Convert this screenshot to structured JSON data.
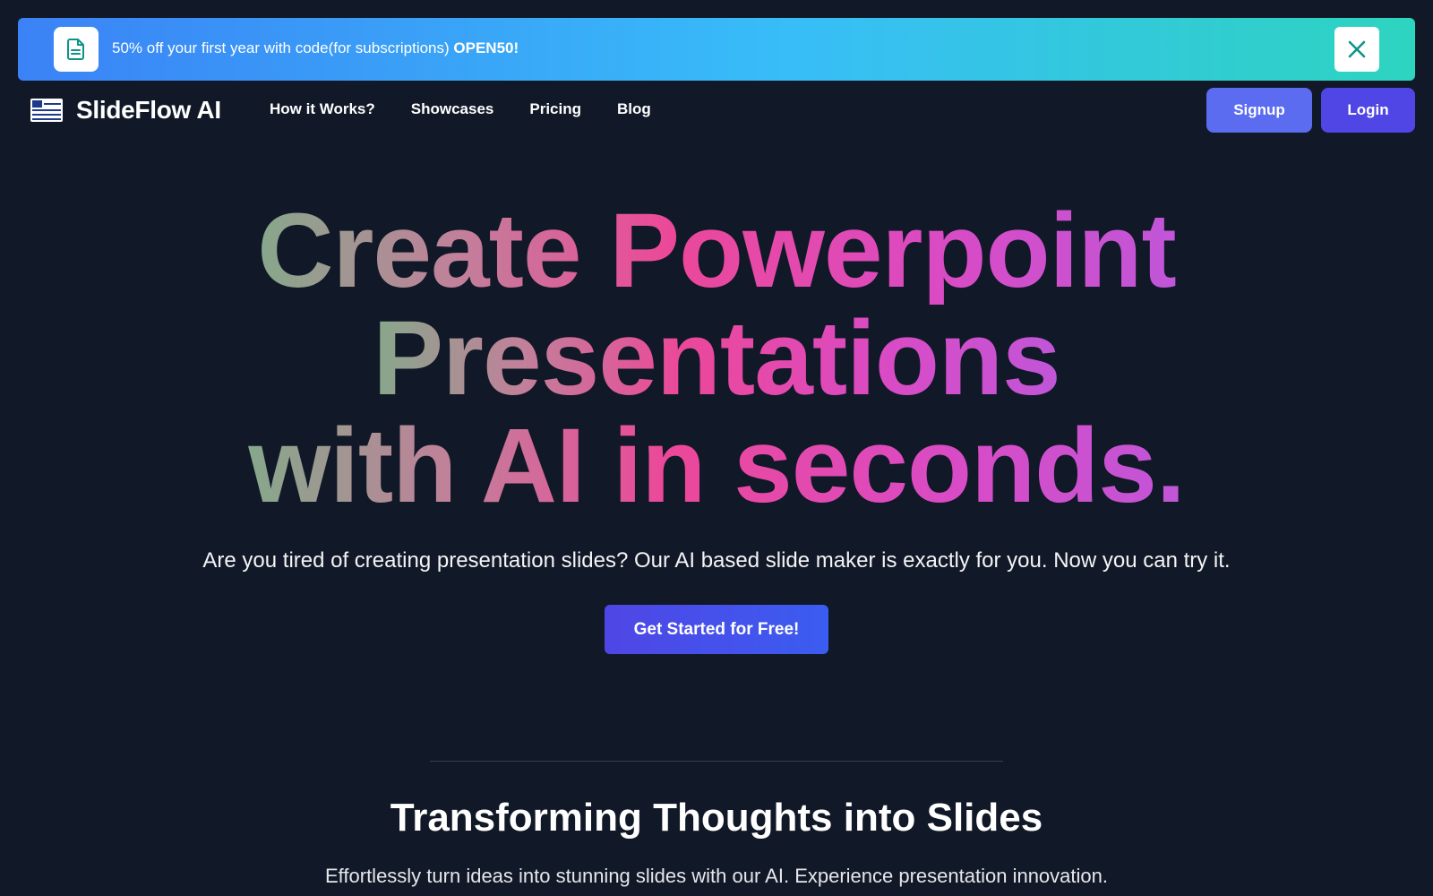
{
  "banner": {
    "text": "50% off your first year with code(for subscriptions) ",
    "code": "OPEN50!"
  },
  "nav": {
    "brand": "SlideFlow AI",
    "links": [
      "How it Works?",
      "Showcases",
      "Pricing",
      "Blog"
    ],
    "signup_label": "Signup",
    "login_label": "Login"
  },
  "hero": {
    "line1": "Create Powerpoint",
    "line2": "Presentations",
    "line3": "with AI in seconds.",
    "subtitle": "Are you tired of creating presentation slides? Our AI based slide maker is exactly for you. Now you can try it.",
    "cta_label": "Get Started for Free!"
  },
  "section": {
    "title": "Transforming Thoughts into Slides",
    "subtitle": "Effortlessly turn ideas into stunning slides with our AI. Experience presentation innovation."
  },
  "colors": {
    "background": "#111827",
    "signup": "#5b6cf0",
    "login": "#4f46e5",
    "accent_pink": "#ec4899"
  },
  "icons": {
    "banner": "document-icon",
    "close": "close-icon",
    "logo": "slides-logo-icon"
  }
}
